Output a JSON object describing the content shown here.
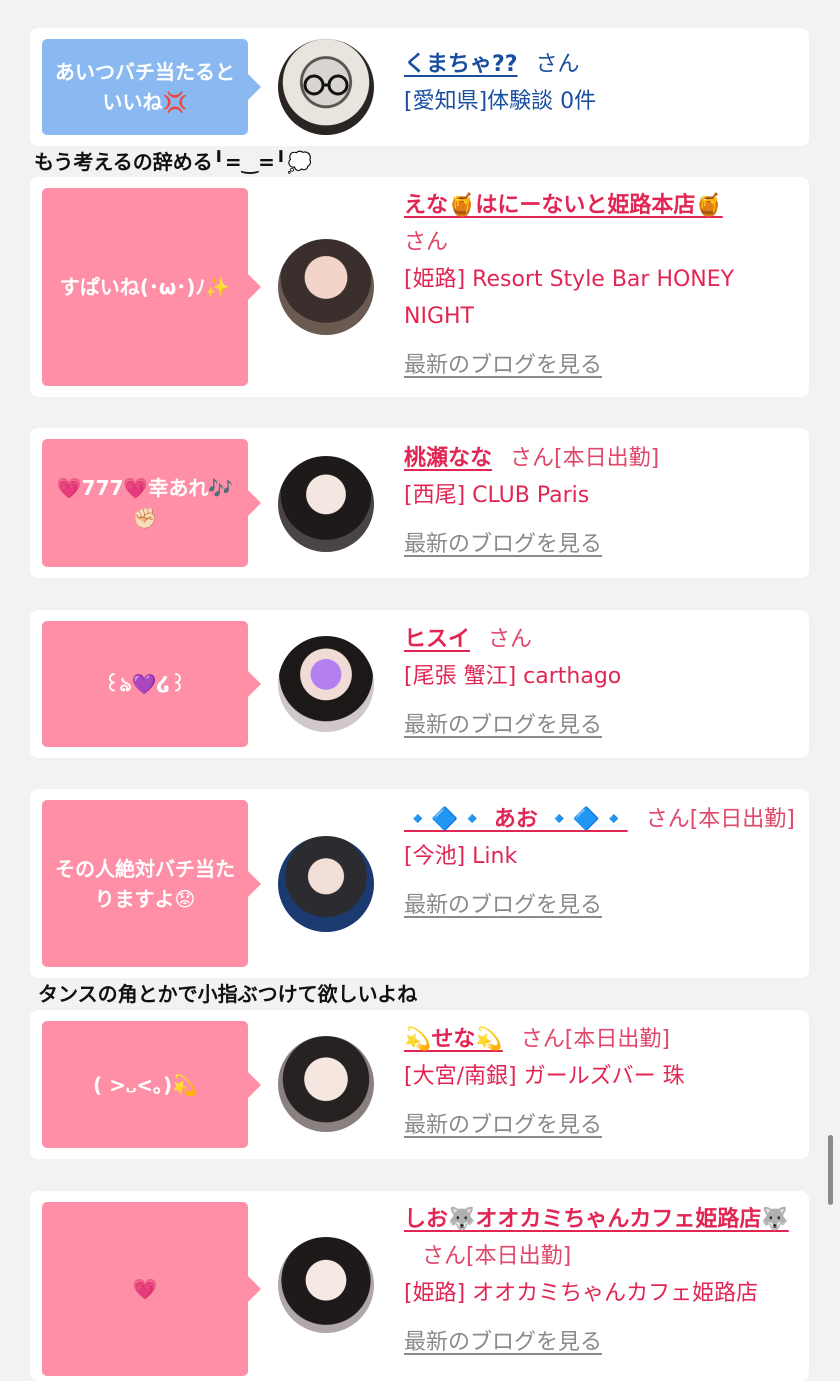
{
  "colors": {
    "bubble_pink": "#ff8fa6",
    "bubble_blue": "#8ab9f1",
    "name_red": "#e22653",
    "name_blue": "#1a4fa0",
    "link_gray": "#8a8a8a"
  },
  "entries": [
    {
      "bubble": "あいつバチ当たるといいね💢",
      "name": "くまちゃ??",
      "san": "さん",
      "shop": "[愛知県]体験談 0件",
      "blog": ""
    },
    {
      "bubble": "すぱいね(･ω･)ﾉ✨",
      "name": "えな🍯はにーないと姫路本店🍯",
      "san": "さん",
      "shop": "[姫路] Resort Style Bar HONEY NIGHT",
      "blog": "最新のブログを見る"
    },
    {
      "bubble": "💗777💗幸あれ🎶✊🏻",
      "name": "桃瀬なな",
      "san": "さん[本日出勤]",
      "shop": "[西尾] CLUB Paris",
      "blog": "最新のブログを見る"
    },
    {
      "bubble": "꒰ঌ💜໒꒱",
      "name": "ヒスイ",
      "san": "さん",
      "shop": "[尾張 蟹江] carthago",
      "blog": "最新のブログを見る"
    },
    {
      "bubble": "その人絶対バチ当たりますよ😟",
      "name": "🔹🔷🔹 あお 🔹🔷🔹",
      "san": "さん[本日出勤]",
      "shop": "[今池] Link",
      "blog": "最新のブログを見る"
    },
    {
      "bubble": "( >᎑<｡)💫",
      "name": "💫せな💫",
      "san": "さん[本日出勤]",
      "shop": "[大宮/南銀] ガールズバー 珠",
      "blog": "最新のブログを見る"
    },
    {
      "bubble": "💗",
      "name": "しお🐺オオカミちゃんカフェ姫路店🐺",
      "san": "さん[本日出勤]",
      "shop": "[姫路] オオカミちゃんカフェ姫路店",
      "blog": "最新のブログを見る"
    }
  ],
  "comments": [
    "もう考えるの辞める╹=‿=╹💭",
    "タンスの角とかで小指ぶつけて欲しいよね"
  ]
}
